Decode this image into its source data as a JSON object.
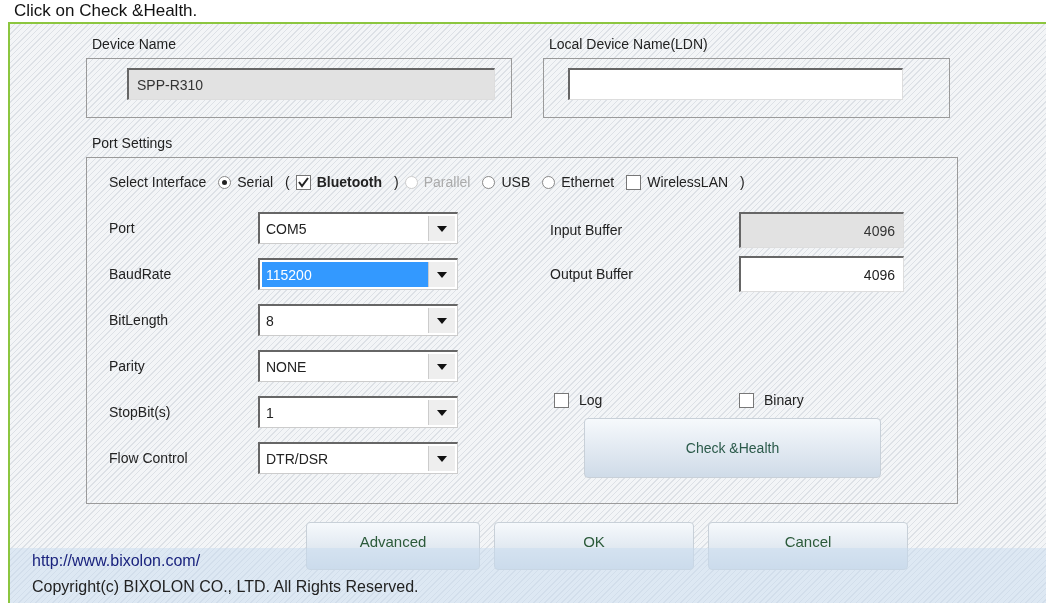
{
  "caption": "Click on Check &Health.",
  "device_name": {
    "label": "Device Name",
    "value": "SPP-R310",
    "disabled": true
  },
  "local_device_name": {
    "label": "Local Device Name(LDN)"
  },
  "port_settings": {
    "title": "Port Settings",
    "select_interface": {
      "label": "Select Interface",
      "options": [
        {
          "kind": "radio",
          "label": "Serial",
          "selected": true,
          "disabled": false
        },
        {
          "kind": "paren",
          "label": "("
        },
        {
          "kind": "checkbox",
          "label": "Bluetooth",
          "checked": true
        },
        {
          "kind": "paren",
          "label": ")"
        },
        {
          "kind": "radio",
          "label": "Parallel",
          "selected": false,
          "disabled": true
        },
        {
          "kind": "radio",
          "label": "USB",
          "selected": false,
          "disabled": false
        },
        {
          "kind": "radio",
          "label": "Ethernet",
          "selected": false,
          "disabled": false
        },
        {
          "kind": "checkbox",
          "label": "WirelessLAN",
          "checked": false
        },
        {
          "kind": "paren",
          "label": ")"
        }
      ]
    },
    "combos": [
      {
        "label": "Port",
        "value": "COM5",
        "selected": false
      },
      {
        "label": "BaudRate",
        "value": "115200",
        "selected": true
      },
      {
        "label": "BitLength",
        "value": "8",
        "selected": false
      },
      {
        "label": "Parity",
        "value": "NONE",
        "selected": false
      },
      {
        "label": "StopBit(s)",
        "value": "1",
        "selected": false
      },
      {
        "label": "Flow Control",
        "value": "DTR/DSR",
        "selected": false
      }
    ],
    "buffers": [
      {
        "label": "Input Buffer",
        "value": "4096",
        "disabled": true
      },
      {
        "label": "Output Buffer",
        "value": "4096",
        "disabled": false
      }
    ],
    "checkboxes": [
      {
        "label": "Log",
        "checked": false
      },
      {
        "label": "Binary",
        "checked": false
      }
    ],
    "check_button": "Check &Health"
  },
  "buttons": [
    "Advanced",
    "OK",
    "Cancel"
  ],
  "footer": {
    "url": "http://www.bixolon.com/",
    "copyright": "Copyright(c) BIXOLON CO., LTD. All Rights Reserved."
  }
}
